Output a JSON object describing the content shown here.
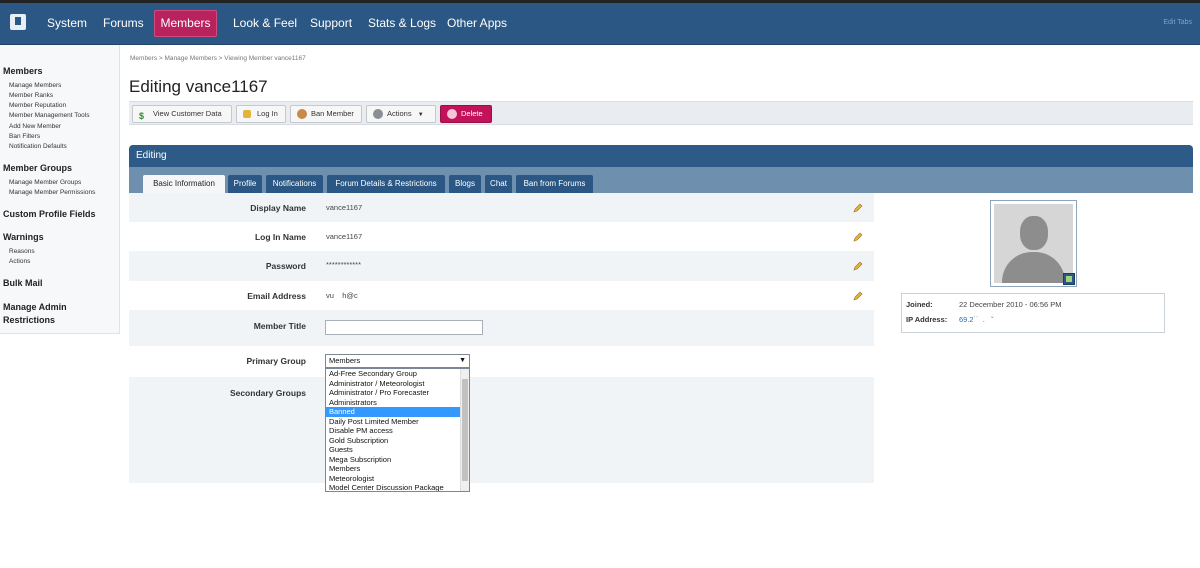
{
  "nav": {
    "items": [
      "System",
      "Forums",
      "Members",
      "Look & Feel",
      "Support",
      "Stats & Logs",
      "Other Apps"
    ],
    "active": "Members",
    "edit_tabs": "Edit Tabs"
  },
  "sidebar": {
    "sections": [
      {
        "title": "Members",
        "links": [
          "Manage Members",
          "Member Ranks",
          "Member Reputation",
          "Member Management Tools",
          "Add New Member",
          "Ban Filters",
          "Notification Defaults"
        ]
      },
      {
        "title": "Member Groups",
        "links": [
          "Manage Member Groups",
          "Manage Member Permissions"
        ]
      },
      {
        "title": "Custom Profile Fields",
        "links": []
      },
      {
        "title": "Warnings",
        "links": [
          "Reasons",
          "Actions"
        ]
      },
      {
        "title": "Bulk Mail",
        "links": []
      },
      {
        "title": "Manage Admin Restrictions",
        "links": []
      }
    ]
  },
  "breadcrumb": "Members  >  Manage Members  >  Viewing Member vance1167",
  "page_title": "Editing vance1167",
  "toolbar": {
    "view_customer_data": "View Customer Data",
    "log_in": "Log In",
    "ban_member": "Ban Member",
    "actions": "Actions",
    "delete": "Delete"
  },
  "panel_title": "Editing",
  "tabs": [
    "Basic Information",
    "Profile",
    "Notifications",
    "Forum Details & Restrictions",
    "Blogs",
    "Chat",
    "Ban from Forums"
  ],
  "active_tab": "Basic Information",
  "form": {
    "display_name_label": "Display Name",
    "display_name": "vance1167",
    "login_name_label": "Log In Name",
    "login_name": "vance1167",
    "password_label": "Password",
    "password": "************",
    "email_label": "Email Address",
    "email": "vu    h@c",
    "member_title_label": "Member Title",
    "member_title_value": "",
    "primary_group_label": "Primary Group",
    "primary_group": "Members",
    "secondary_groups_label": "Secondary Groups",
    "group_options": [
      "Ad-Free Secondary Group",
      "Administrator / Meteorologist",
      "Administrator / Pro Forecaster",
      "Administrators",
      "Banned",
      "Daily Post Limited Member",
      "Disable PM access",
      "Gold Subscription",
      "Guests",
      "Mega Subscription",
      "Members",
      "Meteorologist",
      "Model Center Discussion Package"
    ],
    "highlighted_option": "Banned"
  },
  "member_info": {
    "joined_label": "Joined:",
    "joined": "22 December 2010 - 06:56 PM",
    "ip_label": "IP Address:",
    "ip": "69.2˙˙  .   ˘"
  },
  "colors": {
    "topbar": "#2b5784",
    "active_nav": "#b8235e",
    "delete_button": "#c2135a",
    "selected_option": "#3399ff"
  },
  "icons": {
    "logo": "logo-icon",
    "pencil": "pencil-icon",
    "avatar_edit": "image-edit-icon"
  }
}
